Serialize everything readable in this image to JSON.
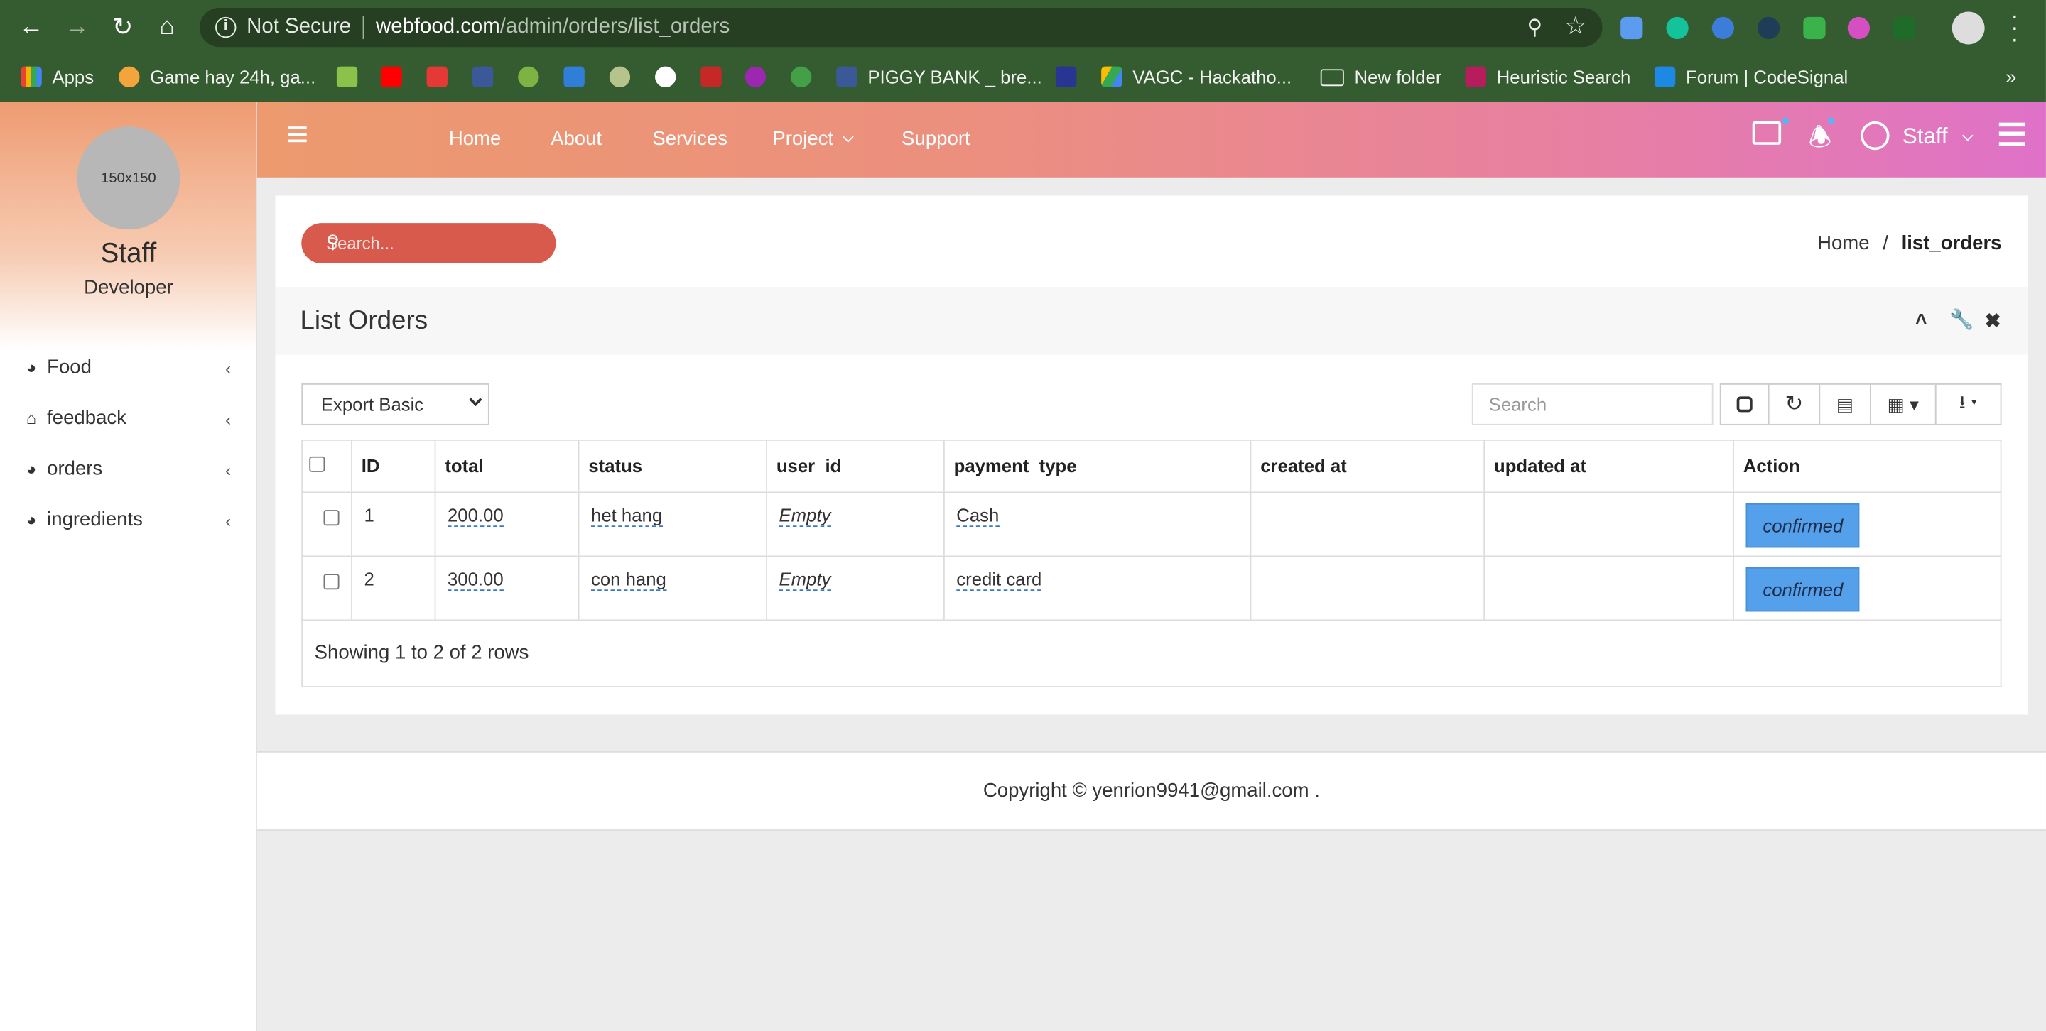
{
  "browser": {
    "security_label": "Not Secure",
    "url_host": "webfood.com",
    "url_path": "/admin/orders/list_orders",
    "bookmarks": [
      {
        "label": "Apps"
      },
      {
        "label": "Game hay 24h, ga..."
      },
      {
        "label": "PIGGY BANK _ bre..."
      },
      {
        "label": "VAGC - Hackatho..."
      },
      {
        "label": "New folder"
      },
      {
        "label": "Heuristic Search"
      },
      {
        "label": "Forum | CodeSignal"
      }
    ]
  },
  "sidebar": {
    "avatar_text": "150x150",
    "user_name": "Staff",
    "user_role": "Developer",
    "items": [
      {
        "label": "Food",
        "icon": "pie-chart-icon"
      },
      {
        "label": "feedback",
        "icon": "home-icon"
      },
      {
        "label": "orders",
        "icon": "pie-chart-icon"
      },
      {
        "label": "ingredients",
        "icon": "pie-chart-icon"
      }
    ]
  },
  "topnav": {
    "links": [
      "Home",
      "About",
      "Services",
      "Project",
      "Support"
    ],
    "user_label": "Staff"
  },
  "content": {
    "search_placeholder": "Search...",
    "breadcrumb": {
      "home": "Home",
      "sep": "/",
      "current": "list_orders"
    },
    "panel_title": "List Orders",
    "export_select": "Export Basic",
    "table_search_placeholder": "Search",
    "columns": [
      "ID",
      "total",
      "status",
      "user_id",
      "payment_type",
      "created at",
      "updated at",
      "Action"
    ],
    "rows": [
      {
        "id": "1",
        "total": "200.00",
        "status": "het hang",
        "user_id": "Empty",
        "payment_type": "Cash",
        "created_at": "",
        "updated_at": "",
        "action": "confirmed"
      },
      {
        "id": "2",
        "total": "300.00",
        "status": "con hang",
        "user_id": "Empty",
        "payment_type": "credit card",
        "created_at": "",
        "updated_at": "",
        "action": "confirmed"
      }
    ],
    "pagination_text": "Showing 1 to 2 of 2 rows"
  },
  "footer": {
    "copyright": "Copyright © yenrion9941@gmail.com ."
  },
  "colors": {
    "accent_blue": "#54a0ea",
    "topbar_start": "#ec9a6e",
    "topbar_end": "#df72c8",
    "search_pill": "#d75a4d"
  }
}
